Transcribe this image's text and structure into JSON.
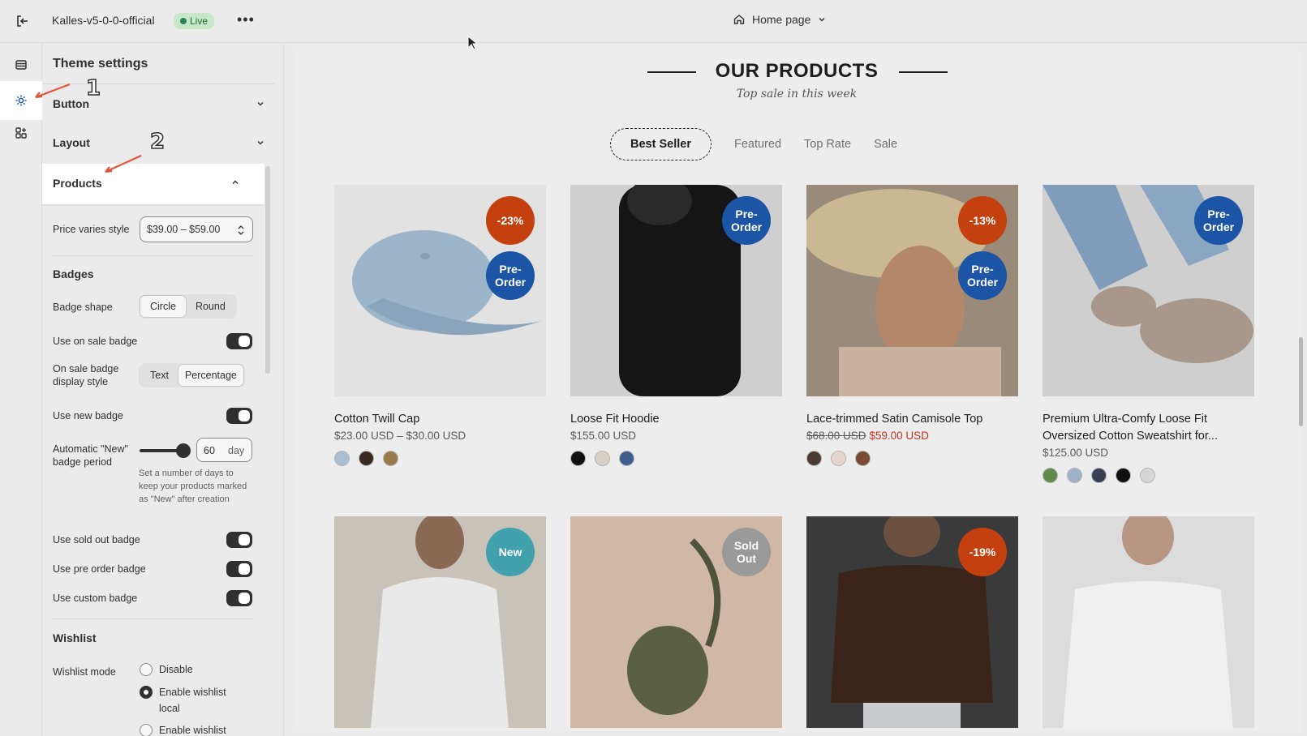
{
  "topbar": {
    "store_name": "Kalles-v5-0-0-official",
    "status": "Live",
    "page": "Home page"
  },
  "panel": {
    "title": "Theme settings",
    "sections": {
      "button": "Button",
      "layout": "Layout",
      "products": "Products"
    },
    "price_varies_style": {
      "label": "Price varies style",
      "value": "$39.00 – $59.00"
    },
    "badges": {
      "title": "Badges",
      "shape_label": "Badge shape",
      "shape_options": [
        "Circle",
        "Round"
      ],
      "shape_selected": "Circle",
      "on_sale_label": "Use on sale badge",
      "display_style_label": "On sale badge display style",
      "display_style_options": [
        "Text",
        "Percentage"
      ],
      "display_style_selected": "Percentage",
      "new_label": "Use new badge",
      "new_period_label": "Automatic \"New\" badge period",
      "new_period_value": "60",
      "new_period_unit": "day",
      "new_period_help": "Set a number of days to keep your products marked as \"New\" after creation",
      "sold_out_label": "Use sold out badge",
      "pre_order_label": "Use pre order badge",
      "custom_label": "Use custom badge"
    },
    "wishlist": {
      "title": "Wishlist",
      "mode_label": "Wishlist mode",
      "options": [
        "Disable",
        "Enable wishlist local",
        "Enable wishlist"
      ],
      "selected": "Enable wishlist local"
    }
  },
  "annotations": {
    "one": "1",
    "two": "2"
  },
  "preview": {
    "title": "OUR PRODUCTS",
    "subtitle": "Top sale in this week",
    "tabs": [
      "Best Seller",
      "Featured",
      "Top Rate",
      "Sale"
    ],
    "active_tab": "Best Seller",
    "products": [
      {
        "name": "Cotton Twill Cap",
        "price": "$23.00 USD – $30.00 USD",
        "badges": [
          "-23%",
          "Pre-Order"
        ]
      },
      {
        "name": "Loose Fit Hoodie",
        "price": "$155.00 USD",
        "badges": [
          "Pre-Order"
        ]
      },
      {
        "name": "Lace-trimmed Satin Camisole Top",
        "old_price": "$68.00 USD",
        "sale_price": "$59.00 USD",
        "badges": [
          "-13%",
          "Pre-Order"
        ]
      },
      {
        "name": "Premium Ultra-Comfy Loose Fit Oversized Cotton Sweatshirt for...",
        "price": "$125.00 USD",
        "badges": [
          "Pre-Order"
        ]
      },
      {
        "name": "",
        "badges": [
          "New"
        ]
      },
      {
        "name": "",
        "badges": [
          "Sold Out"
        ]
      },
      {
        "name": "",
        "badges": [
          "-19%"
        ]
      },
      {
        "name": "",
        "badges": []
      }
    ]
  },
  "colors": {
    "sale_badge": "#c5400f",
    "preorder_badge": "#1c54a6",
    "new_badge": "#41a2ad",
    "soldout_badge": "#9a9a9a",
    "sale_price": "#c2321f"
  }
}
